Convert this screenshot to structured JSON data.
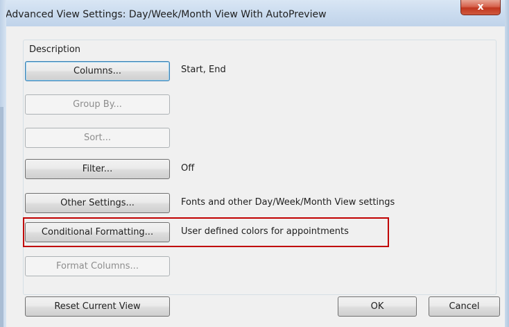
{
  "window": {
    "title": "Advanced View Settings: Day/Week/Month View With AutoPreview",
    "close_glyph": "x"
  },
  "description_group": {
    "label": "Description"
  },
  "rows": [
    {
      "button": "Columns...",
      "description": "Start, End",
      "enabled": true
    },
    {
      "button": "Group By...",
      "description": "",
      "enabled": false
    },
    {
      "button": "Sort...",
      "description": "",
      "enabled": false
    },
    {
      "button": "Filter...",
      "description": "Off",
      "enabled": true
    },
    {
      "button": "Other Settings...",
      "description": "Fonts and other Day/Week/Month View settings",
      "enabled": true
    },
    {
      "button": "Conditional Formatting...",
      "description": "User defined colors for appointments",
      "enabled": true
    },
    {
      "button": "Format Columns...",
      "description": "",
      "enabled": false
    }
  ],
  "footer": {
    "reset_label": "Reset Current View",
    "ok_label": "OK",
    "cancel_label": "Cancel"
  },
  "colors": {
    "highlight": "#c00000",
    "focus_border": "#3c7fb1"
  }
}
